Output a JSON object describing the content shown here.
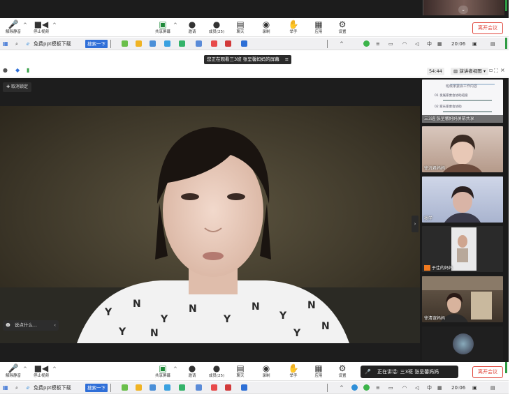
{
  "toolbar": {
    "mute": "解除静音",
    "stop_video": "停止视频",
    "share": "共享屏幕",
    "invite": "邀请",
    "members": "成员(25)",
    "chat": "聊天",
    "record": "录制",
    "raise_hand": "举手",
    "apps": "应用",
    "settings": "设置",
    "leave": "离开会议"
  },
  "taskbar": {
    "browser_label": "免费ppt模板下载",
    "search_button": "搜索一下",
    "ime": "中",
    "time": "20:06",
    "caret_up": "^"
  },
  "notify": {
    "text": "您正在观看三3班 张呈馨妈妈的屏幕"
  },
  "window": {
    "timer": "54:44",
    "presenter_view": "演讲者视图"
  },
  "main": {
    "cancel_lock": "取消锁定",
    "chat_placeholder": "说点什么..."
  },
  "participants": [
    {
      "name": "三3班 张呈馨妈妈屏幕共享"
    },
    {
      "name": "徐沅君妈妈"
    },
    {
      "name": "杨学"
    },
    {
      "name": "于佳的妈妈"
    },
    {
      "name": "徐清谊妈妈"
    }
  ],
  "shared_doc": {
    "lines": [
      "班级家委会工作内容",
      "01 发展家委会协助班级",
      "02 家长家委会协助"
    ]
  },
  "speaking": {
    "text": "正在讲话: 三3班 张呈馨妈妈"
  },
  "colors": {
    "accent_blue": "#2f6fd8",
    "leave_red": "#e0453b",
    "mic_red": "#d9342b"
  }
}
